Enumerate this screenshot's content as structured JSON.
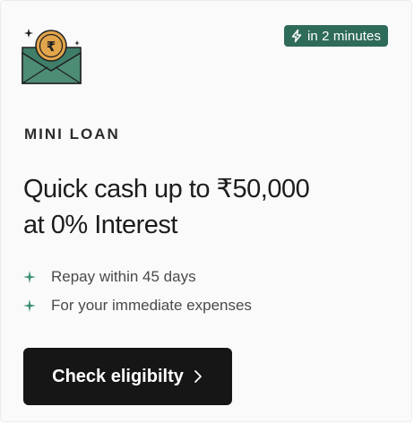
{
  "card": {
    "badge": {
      "icon": "lightning-icon",
      "label": "in 2 minutes"
    },
    "icon": "envelope-rupee-coin-icon",
    "product_name": "MINI LOAN",
    "headline_line1": "Quick cash up to ₹50,000",
    "headline_line2": "at 0% Interest",
    "features": [
      {
        "icon": "sparkle-icon",
        "text": "Repay within 45 days"
      },
      {
        "icon": "sparkle-icon",
        "text": "For your immediate expenses"
      }
    ],
    "cta": {
      "label": "Check eligibilty",
      "icon": "chevron-right-icon"
    }
  },
  "colors": {
    "accent_green": "#2f6b5a",
    "coin_gold": "#e2a54b",
    "button_bg": "#161616",
    "card_bg": "#fafafa"
  }
}
